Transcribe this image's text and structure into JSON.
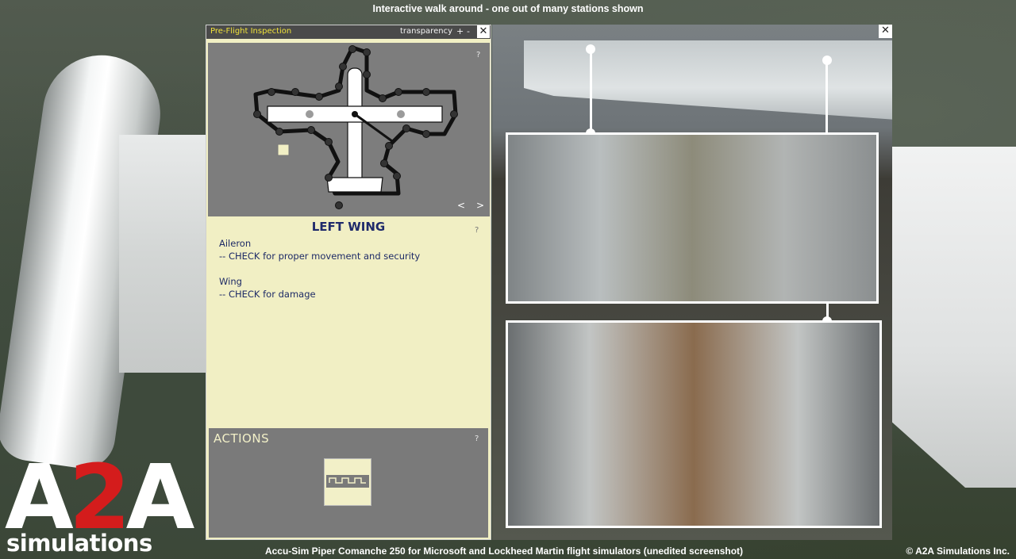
{
  "captions": {
    "top": "Interactive walk around - one out of many stations shown",
    "bottom": "Accu-Sim Piper Comanche 250 for Microsoft and Lockheed Martin flight simulators (unedited screenshot)",
    "copyright": "© A2A Simulations Inc."
  },
  "logo": {
    "a": "A",
    "two": "2",
    "a2": "A",
    "subtitle": "simulations"
  },
  "panel": {
    "title": "Pre-Flight Inspection",
    "transparency_label": "transparency",
    "plus": "+",
    "minus": "-",
    "close": "✕",
    "map_help": "?",
    "prev": "<",
    "next": ">",
    "station_title": "LEFT WING",
    "station_help": "?",
    "checklist": [
      {
        "heading": "Aileron",
        "detail": "-- CHECK for proper movement and security"
      },
      {
        "heading": "Wing",
        "detail": "-- CHECK for damage"
      }
    ],
    "actions_label": "ACTIONS",
    "actions_help": "?"
  },
  "viewer": {
    "close": "✕"
  },
  "colors": {
    "panel_bg": "#f1efc4",
    "title_yellow": "#f0e23a",
    "checklist_text": "#1d2a66",
    "logo_red": "#d41c1c"
  }
}
